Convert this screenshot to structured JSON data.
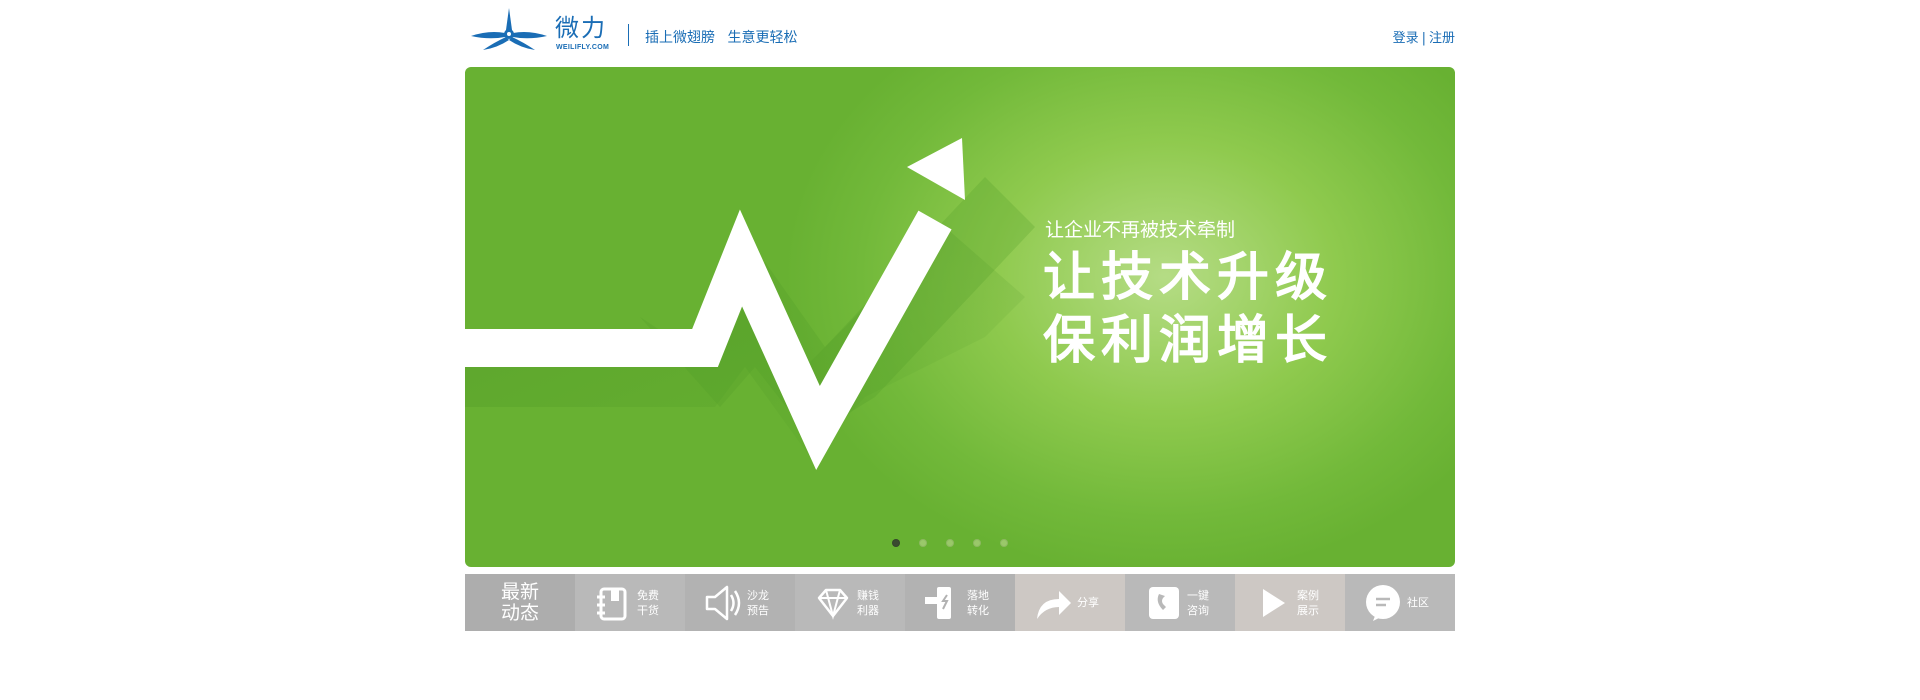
{
  "header": {
    "logo": {
      "name": "微力",
      "domain": "WEILIFLY.COM"
    },
    "slogan": "插上微翅膀 生意更轻松",
    "auth": {
      "login": "登录",
      "separator": "|",
      "register": "注册"
    }
  },
  "banner": {
    "small_text": "让企业不再被技术牵制",
    "headline_line1": "让技术升级",
    "headline_line2": "保利润增长",
    "slides": 5,
    "active_slide": 1
  },
  "nav": {
    "news_title": "最新\n动态",
    "items": [
      {
        "label": "免费\n干货",
        "icon": "book-icon",
        "bg": "#b9b9b9"
      },
      {
        "label": "沙龙\n预告",
        "icon": "speaker-icon",
        "bg": "#b2b2b2"
      },
      {
        "label": "赚钱\n利器",
        "icon": "diamond-icon",
        "bg": "#b9b9b9"
      },
      {
        "label": "落地\n转化",
        "icon": "hammer-icon",
        "bg": "#b2b2b2"
      },
      {
        "label": "分享",
        "icon": "share-arrow-icon",
        "bg": "#cdc8c4"
      },
      {
        "label": "一键\n咨询",
        "icon": "phone-icon",
        "bg": "#b9b9b9"
      },
      {
        "label": "案例\n展示",
        "icon": "play-icon",
        "bg": "#cdc8c4"
      },
      {
        "label": "社区",
        "icon": "chat-bubble-icon",
        "bg": "#b9b9b9"
      }
    ],
    "news_bg": "#adadad"
  },
  "colors": {
    "brand_blue": "#1a6db5",
    "banner_green": "#72b93a"
  }
}
